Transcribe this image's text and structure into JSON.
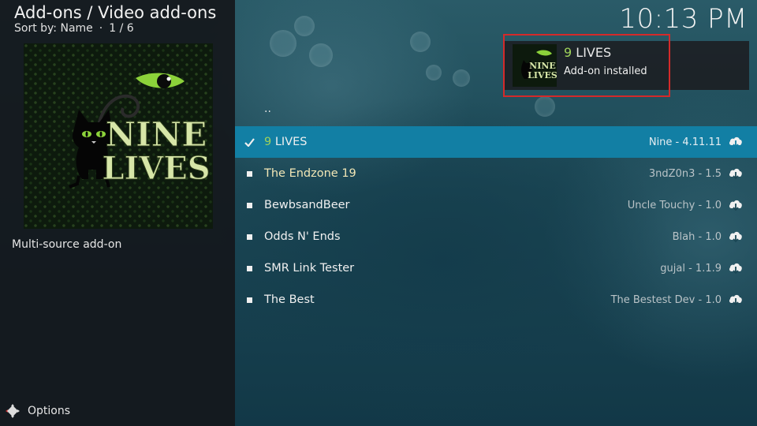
{
  "header": {
    "title": "Add-ons / Video add-ons",
    "sort_label": "Sort by: Name",
    "sort_separator": "·",
    "page_count": "1 / 6"
  },
  "clock": "10:13 PM",
  "poster": {
    "logo_line1": "NINE",
    "logo_line2": "LIVES"
  },
  "description": "Multi-source add-on",
  "options_label": "Options",
  "notification": {
    "title_num": "9",
    "title_rest": " LIVES",
    "body": "Add-on installed",
    "thumb_line1": "NINE",
    "thumb_line2": "LIVES",
    "highlight_color": "#d42a2a"
  },
  "list": {
    "parent": "..",
    "items": [
      {
        "name_num": "9",
        "name_rest": " LIVES",
        "version": "Nine - 4.11.11",
        "state": "installed"
      },
      {
        "name": "The Endzone 19",
        "version": "3ndZ0n3 - 1.5"
      },
      {
        "name": "BewbsandBeer",
        "version": "Uncle Touchy - 1.0"
      },
      {
        "name": "Odds N' Ends",
        "version": "Blah - 1.0"
      },
      {
        "name": "SMR Link Tester",
        "version": "gujal - 1.1.9"
      },
      {
        "name": "The Best",
        "version": "The Bestest Dev - 1.0"
      }
    ]
  },
  "colors": {
    "focus": "#127fa4",
    "accent_green": "#9fd25a",
    "item_yellow": "#f2e7b6"
  },
  "icons": [
    "check-icon",
    "bullet-icon",
    "cloud-download-icon",
    "options-icon"
  ]
}
